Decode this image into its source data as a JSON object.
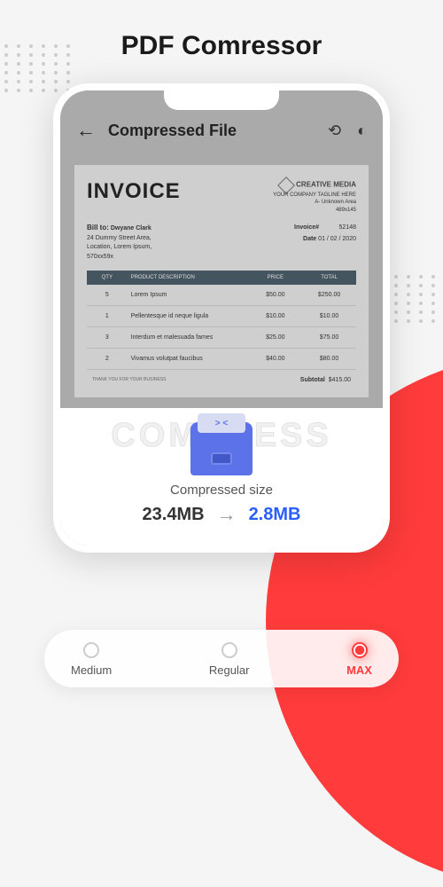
{
  "page_title": "PDF Comressor",
  "app": {
    "header_title": "Compressed File"
  },
  "invoice": {
    "title": "INVOICE",
    "company": {
      "name": "CREATIVE MEDIA",
      "tagline": "YOUR COMPANY TAGLINE HERE",
      "address1": "A- Unknown Area",
      "address2": "489x145"
    },
    "bill_to": {
      "label": "Bill to:",
      "name": "Dwyane Clark",
      "line1": "24 Dummy Street Area,",
      "line2": "Location, Lorem Ipsum,",
      "line3": "570xx59x"
    },
    "meta": {
      "invoice_label": "Invoice#",
      "invoice_number": "52148",
      "date_label": "Date",
      "date_value": "01 / 02 / 2020"
    },
    "columns": {
      "qty": "QTY",
      "desc": "PRODUCT DESCRIPTION",
      "price": "PRICE",
      "total": "TOTAL"
    },
    "rows": [
      {
        "qty": "5",
        "desc": "Lorem Ipsum",
        "price": "$50.00",
        "total": "$250.00"
      },
      {
        "qty": "1",
        "desc": "Pellentesque id neque ligula",
        "price": "$10.00",
        "total": "$10.00"
      },
      {
        "qty": "3",
        "desc": "Interdum et malesuada fames",
        "price": "$25.00",
        "total": "$75.00"
      },
      {
        "qty": "2",
        "desc": "Vivamus volutpat faucibus",
        "price": "$40.00",
        "total": "$80.00"
      }
    ],
    "footer": {
      "thank_you": "THANK YOU FOR YOUR BUSINESS",
      "subtotal_label": "Subtotal",
      "subtotal_value": "$415.00"
    }
  },
  "compression": {
    "bg_text": "COMPRESS",
    "label": "Compressed size",
    "size_before": "23.4MB",
    "arrow": "→",
    "size_after": "2.8MB"
  },
  "levels": [
    {
      "label": "Medium",
      "active": false
    },
    {
      "label": "Regular",
      "active": false
    },
    {
      "label": "MAX",
      "active": true
    }
  ]
}
